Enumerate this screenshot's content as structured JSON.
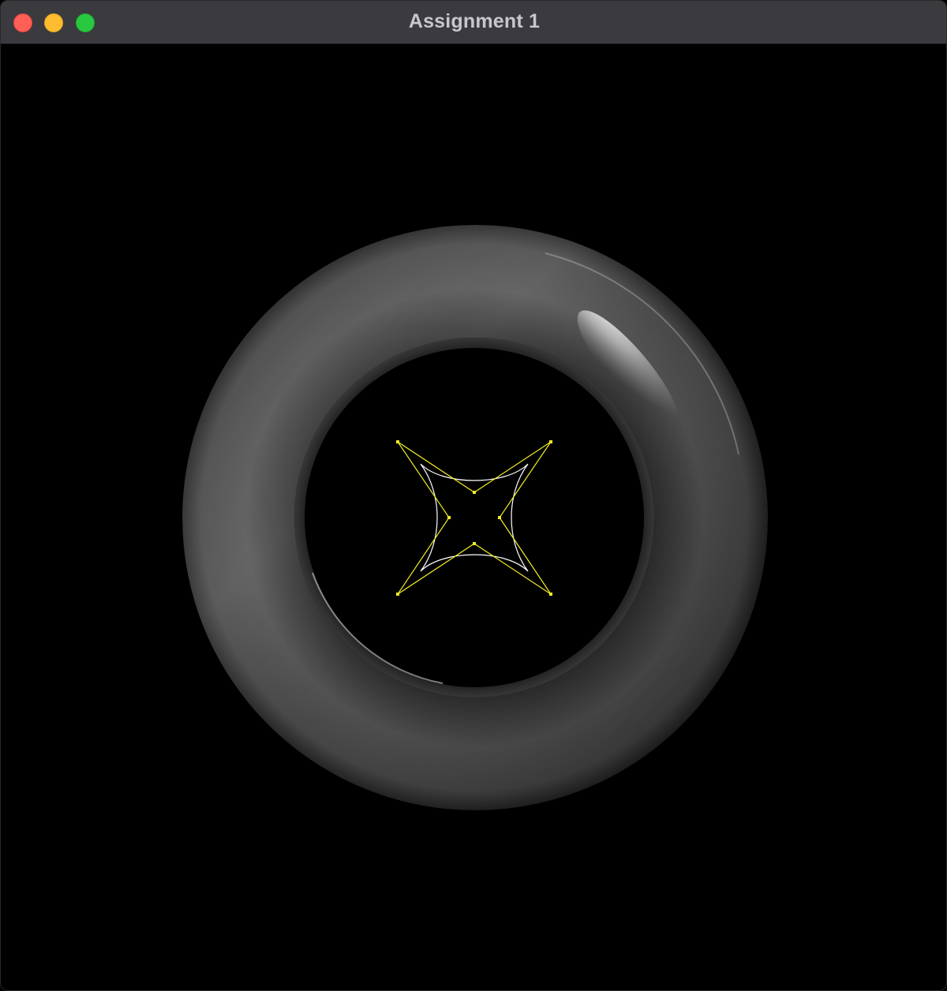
{
  "window": {
    "title": "Assignment 1"
  },
  "colors": {
    "titlebar": "#3b3a3f",
    "title_text": "#c8c7cc",
    "close": "#fe5f57",
    "minimize": "#febc2e",
    "zoom": "#28c840",
    "background": "#000000",
    "control_polygon": "#f2ee22",
    "curve": "#ffffff"
  },
  "icons": {
    "close": "close-icon",
    "minimize": "minimize-icon",
    "zoom": "zoom-icon"
  }
}
